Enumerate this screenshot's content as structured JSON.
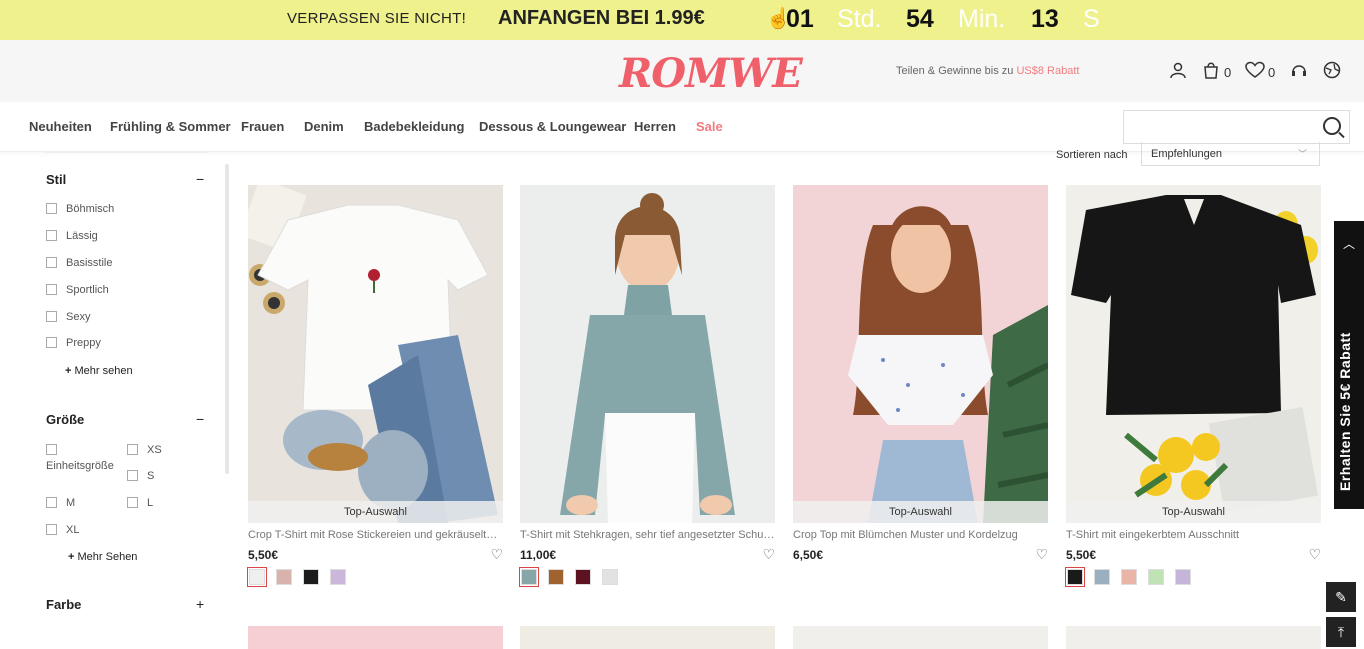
{
  "promo": {
    "label1": "VERPASSEN SIE NICHT!",
    "label2": "ANFANGEN BEI 1.99€",
    "days": "01",
    "days_unit": "Std.",
    "hours": "54",
    "hours_unit": "Min.",
    "mins": "13",
    "mins_unit": "S"
  },
  "header": {
    "logo": "ROMWE",
    "share_text": "Teilen & Gewinne bis zu ",
    "share_amount": "US$8 Rabatt",
    "cart_count": "0",
    "wish_count": "0"
  },
  "nav": {
    "items": [
      "Neuheiten",
      "Frühling & Sommer",
      "Frauen",
      "Denim",
      "Badebekleidung",
      "Dessous & Loungewear",
      "Herren",
      "Sale"
    ],
    "search_placeholder": ""
  },
  "sort": {
    "label": "Sortieren nach",
    "value": "Empfehlungen"
  },
  "filters": {
    "style": {
      "title": "Stil",
      "sign": "−",
      "items": [
        "Böhmisch",
        "Lässig",
        "Basisstile",
        "Sportlich",
        "Sexy",
        "Preppy"
      ],
      "more": "Mehr sehen"
    },
    "size": {
      "title": "Größe",
      "sign": "−",
      "items": [
        "Einheitsgröße",
        "XS",
        "S",
        "M",
        "L",
        "XL"
      ],
      "more": "Mehr Sehen"
    },
    "color": {
      "title": "Farbe",
      "sign": "+"
    }
  },
  "products": [
    {
      "title": "Crop T-Shirt mit Rose Stickereien und gekräuselter Saum",
      "price": "5,50€",
      "badge": "Top-Auswahl",
      "swatches": [
        "#eef0ee",
        "#d9b2ae",
        "#1c1c1c",
        "#cdb6dc"
      ]
    },
    {
      "title": "T-Shirt mit Stehkragen, sehr tief angesetzter Schulter",
      "price": "11,00€",
      "badge": "",
      "swatches": [
        "#86a6a8",
        "#a0622e",
        "#5c1220",
        "#e2e2e2"
      ]
    },
    {
      "title": "Crop Top mit Blümchen Muster und Kordelzug",
      "price": "6,50€",
      "badge": "Top-Auswahl",
      "swatches": []
    },
    {
      "title": "T-Shirt mit eingekerbtem Ausschnitt",
      "price": "5,50€",
      "badge": "Top-Auswahl",
      "swatches": [
        "#1a1a1a",
        "#9ab0c0",
        "#e8b5a8",
        "#bfe3b4",
        "#c5b5d8"
      ]
    }
  ],
  "side_tab": {
    "label": "Erhalten Sie 5€ Rabatt"
  },
  "colors": {
    "promo_bg": "#eef18c",
    "brand": "#f0606a",
    "sale": "#f07c80"
  }
}
